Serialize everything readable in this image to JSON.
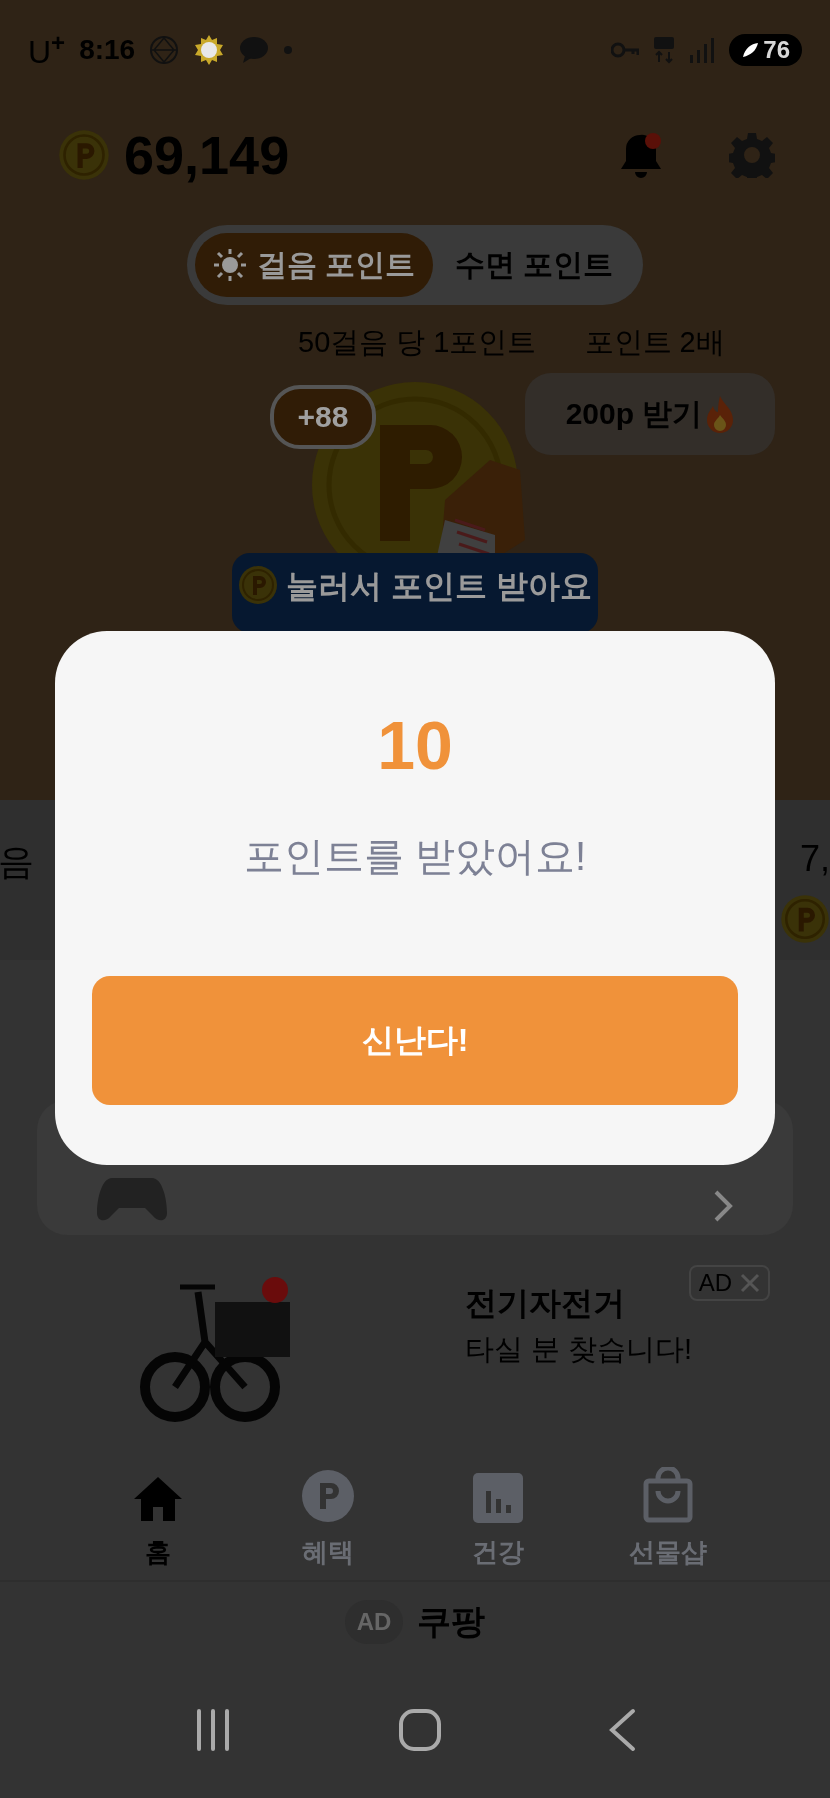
{
  "status_bar": {
    "carrier": "U$^{+}$",
    "time": "8:16",
    "battery": "76"
  },
  "header": {
    "points": "69,149"
  },
  "mode_tabs": [
    {
      "label": "걸음 포인트",
      "selected": true
    },
    {
      "label": "수면 포인트",
      "selected": false
    }
  ],
  "rate_info": [
    "50걸음 당 1포인트",
    "포인트 2배"
  ],
  "bonus_badge": "+88",
  "reward_button": "200p 받기",
  "tooltip": "눌러서 포인트 받아요",
  "stats_band": {
    "left_text": "음",
    "right_text": "7,"
  },
  "ad_banner": {
    "ad_label": "AD",
    "title": "전기자전거",
    "subtitle": "타실 분 찾습니다!"
  },
  "bottom_nav": [
    {
      "kind": "home",
      "label": "홈",
      "selected": true
    },
    {
      "kind": "coin",
      "label": "혜택",
      "selected": false
    },
    {
      "kind": "chart",
      "label": "건강",
      "selected": false
    },
    {
      "kind": "bag",
      "label": "선물샵",
      "selected": false
    }
  ],
  "footer_ad": {
    "ad_label": "AD",
    "name": "쿠팡"
  },
  "dialog": {
    "amount": "10",
    "message": "포인트를 받았어요!",
    "confirm": "신난다!"
  }
}
